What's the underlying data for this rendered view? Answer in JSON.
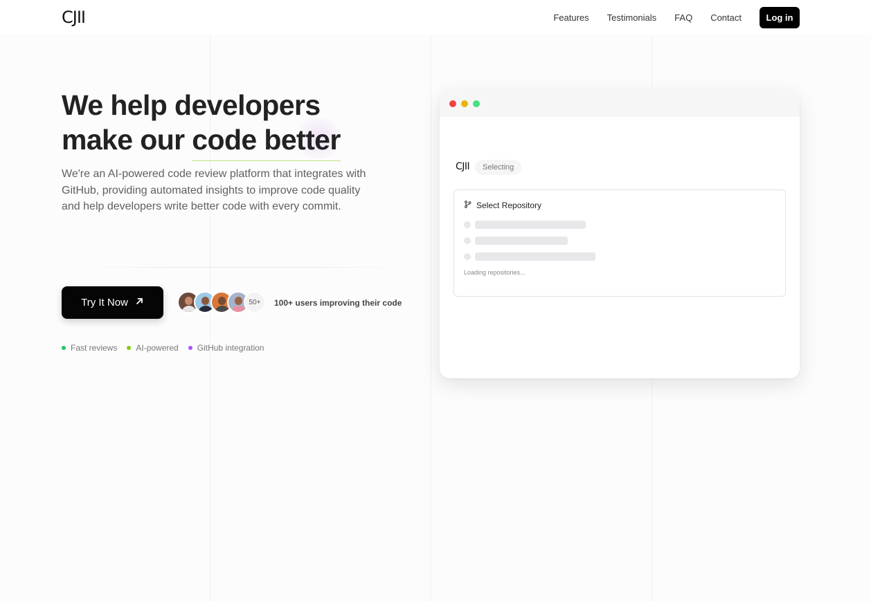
{
  "header": {
    "logo": "CJII",
    "nav": [
      "Features",
      "Testimonials",
      "FAQ",
      "Contact"
    ],
    "login_label": "Log in"
  },
  "hero": {
    "title_part1": "We help developers make our ",
    "title_highlight": "code better",
    "description": "We're an AI-powered code review platform that integrates with GitHub, providing automated insights to improve code quality and help developers write better code with every commit.",
    "cta_label": "Try It Now",
    "cta_icon": "arrow-up-right-icon",
    "avatar_count": "50+",
    "users_text": "100+ users improving their code",
    "tags": [
      {
        "label": "Fast reviews",
        "color": "#22c55e"
      },
      {
        "label": "AI-powered",
        "color": "#84cc16"
      },
      {
        "label": "GitHub integration",
        "color": "#a855f7"
      }
    ]
  },
  "window": {
    "traffic_lights": [
      "#ef4444",
      "#eab308",
      "#4ade80"
    ],
    "logo": "CJII",
    "status": "Selecting",
    "repo_title": "Select Repository",
    "repo_icon": "git-branch-icon",
    "loading_text": "Loading repositories..."
  },
  "colors": {
    "accent_underline": "#b9e27f",
    "button_dark": "#050505"
  }
}
